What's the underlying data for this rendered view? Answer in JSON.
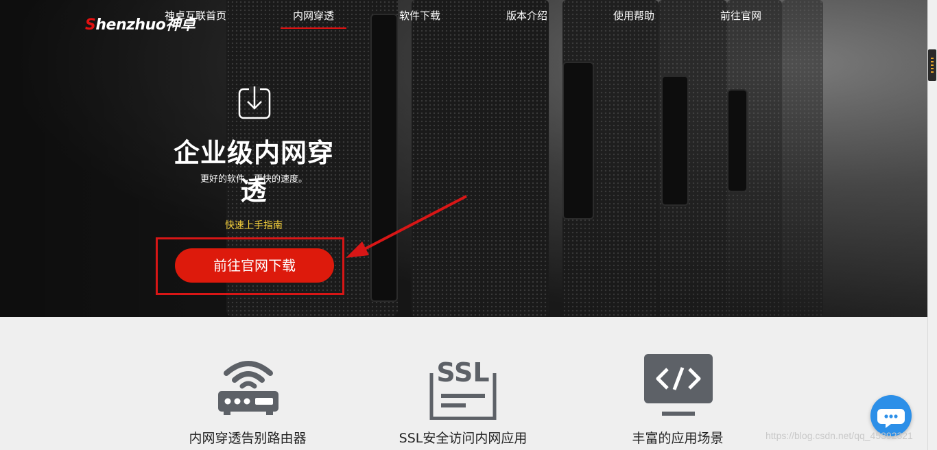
{
  "brand": {
    "logo_initial": "S",
    "logo_rest": "henzhuo神卓"
  },
  "nav": {
    "items": [
      {
        "label": "神卓互联首页"
      },
      {
        "label": "内网穿透"
      },
      {
        "label": "软件下载"
      },
      {
        "label": "版本介绍"
      },
      {
        "label": "使用帮助"
      },
      {
        "label": "前往官网"
      }
    ],
    "active_index": 1
  },
  "hero": {
    "icon": "download-box-icon",
    "title": "企业级内网穿透",
    "subtitle": "更好的软件，更快的速度。",
    "guide_link": "快速上手指南",
    "cta_label": "前往官网下载"
  },
  "features": [
    {
      "icon": "router-wifi-icon",
      "label": "内网穿透告别路由器"
    },
    {
      "icon": "ssl-certificate-icon",
      "label": "SSL安全访问内网应用"
    },
    {
      "icon": "code-monitor-icon",
      "label": "丰富的应用场景"
    }
  ],
  "chat": {
    "icon": "chat-bubble-icon"
  },
  "watermark": "https://blog.csdn.net/qq_45392321",
  "colors": {
    "accent_red": "#dd1a0c",
    "guide_yellow": "#f6d13a",
    "chat_blue": "#2c8fe8",
    "icon_gray": "#5d6167"
  }
}
